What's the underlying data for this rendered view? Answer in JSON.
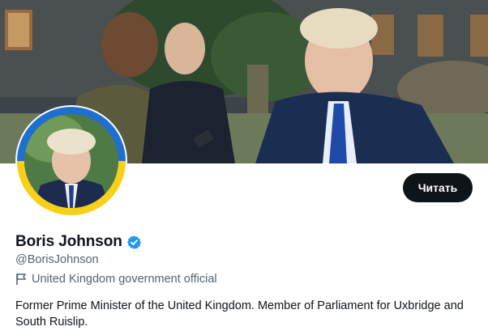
{
  "profile": {
    "display_name": "Boris Johnson",
    "handle": "@BorisJohnson",
    "affiliation": "United Kingdom government official",
    "bio": "Former Prime Minister of the United Kingdom. Member of Parliament for Uxbridge and South Ruislip.",
    "verified_icon": "verified-badge-icon",
    "affiliation_icon": "flag-icon"
  },
  "actions": {
    "follow_label": "Читать"
  },
  "colors": {
    "follow_bg": "#0f1419",
    "verified_blue": "#1d9bf0",
    "ring_blue": "#1f6fd1",
    "ring_yellow": "#f8d019",
    "secondary_text": "#536471"
  }
}
